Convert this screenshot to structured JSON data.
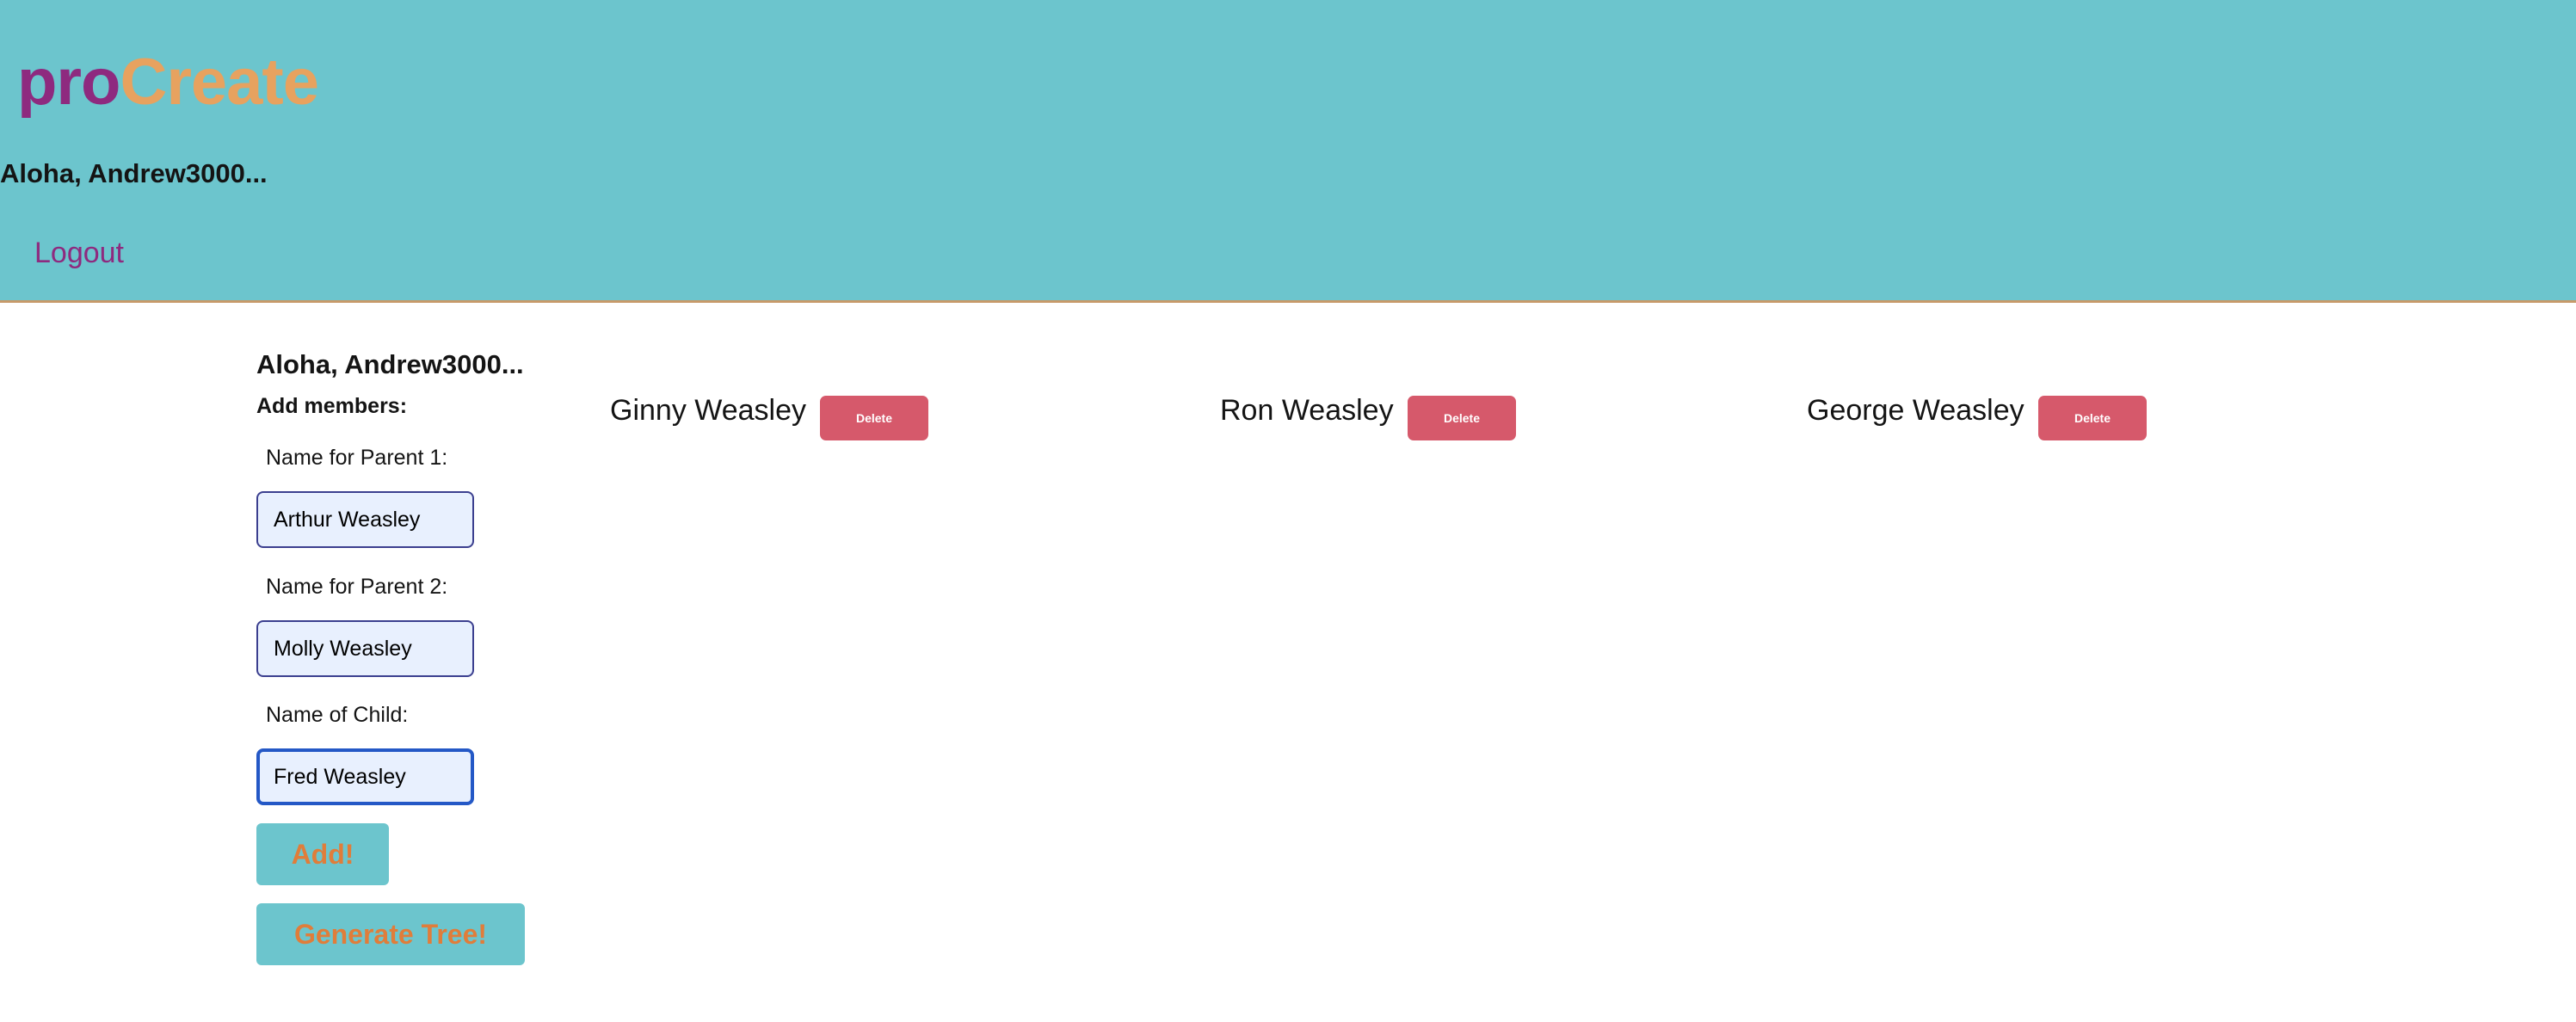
{
  "header": {
    "logo_part1": "pro",
    "logo_part2": "Create",
    "greeting": "Aloha, Andrew3000...",
    "logout_label": "Logout"
  },
  "form": {
    "greeting": "Aloha, Andrew3000...",
    "heading": "Add members:",
    "parent1_label": "Name for Parent 1:",
    "parent1_value": "Arthur Weasley",
    "parent2_label": "Name for Parent 2:",
    "parent2_value": "Molly Weasley",
    "child_label": "Name of Child:",
    "child_value": "Fred Weasley",
    "add_label": "Add!",
    "generate_label": "Generate Tree!"
  },
  "members": [
    {
      "name": "Ginny Weasley",
      "delete_label": "Delete"
    },
    {
      "name": "Ron Weasley",
      "delete_label": "Delete"
    },
    {
      "name": "George Weasley",
      "delete_label": "Delete"
    }
  ],
  "colors": {
    "header_bg": "#6cc5cd",
    "logo_pro": "#8e2a7f",
    "logo_create": "#e7a25f",
    "logout": "#8e2a7f",
    "button_text": "#e07d3a",
    "delete_bg": "#d6596b"
  }
}
